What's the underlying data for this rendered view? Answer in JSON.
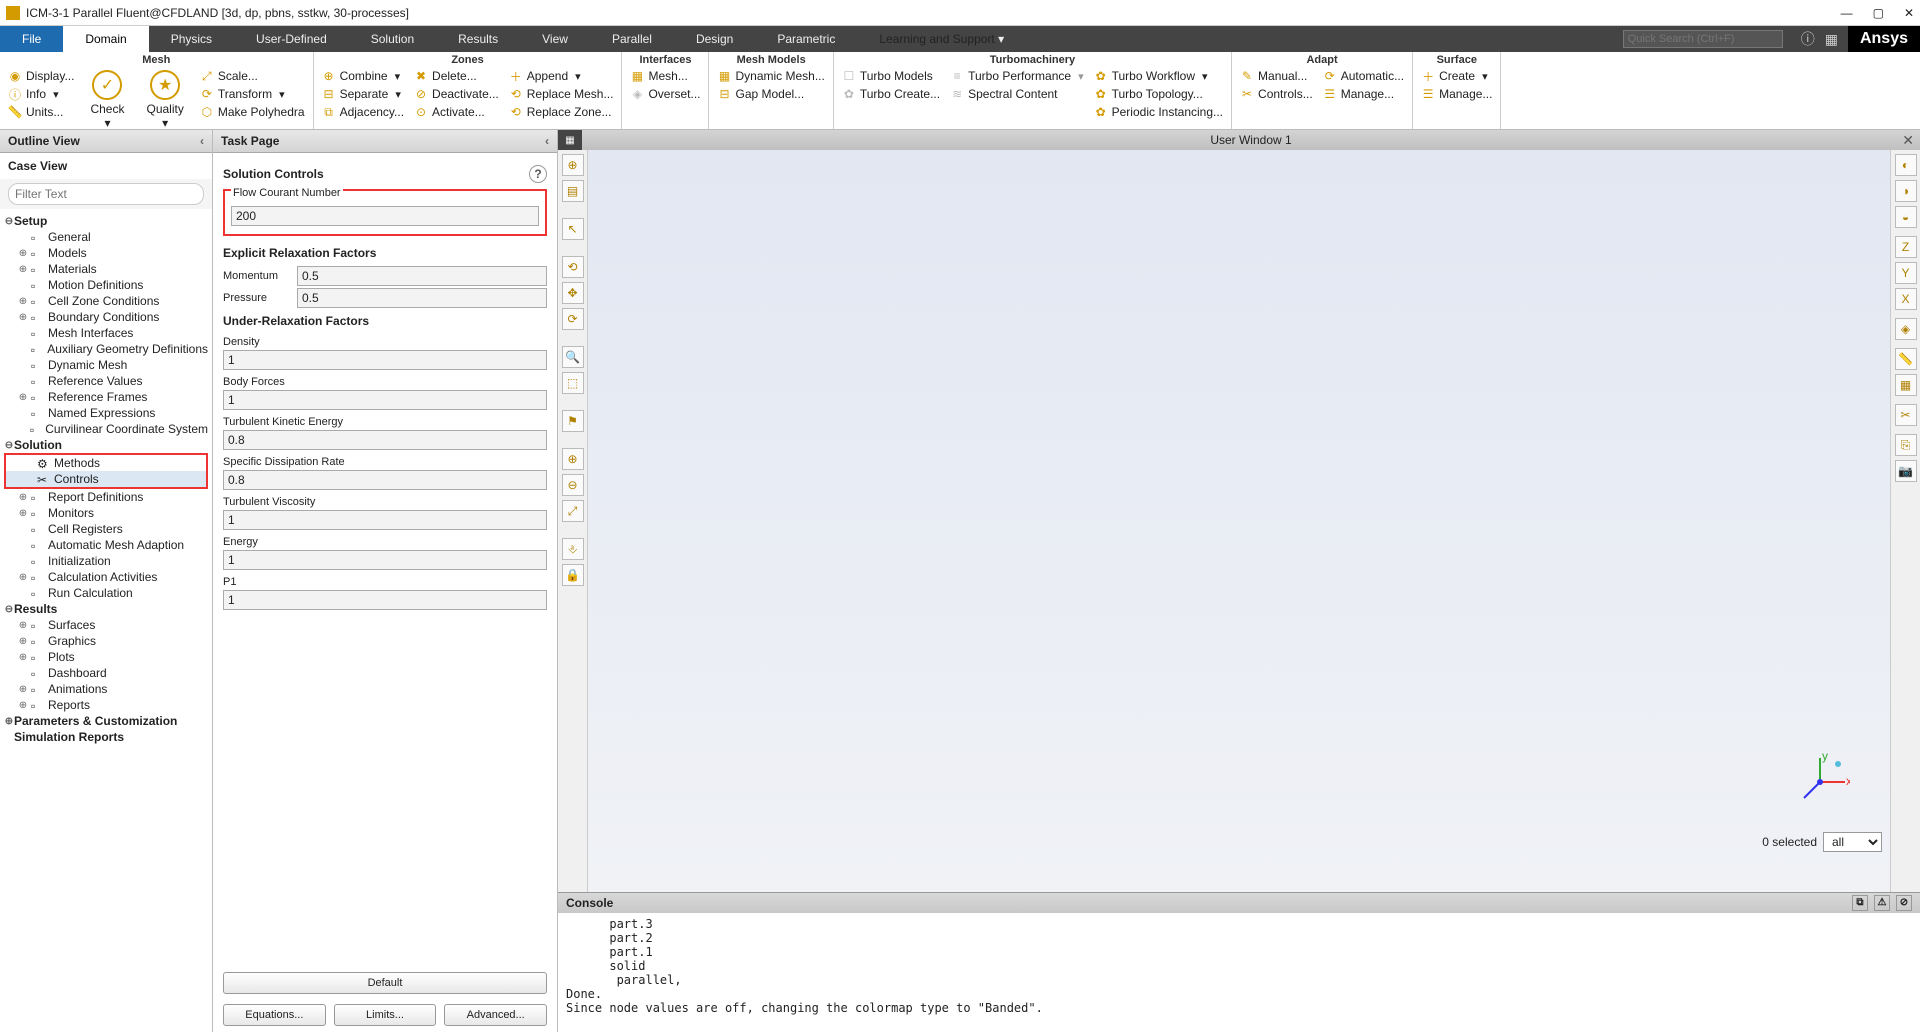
{
  "title": "ICM-3-1 Parallel Fluent@CFDLAND  [3d, dp, pbns, sstkw, 30-processes]",
  "menu": {
    "file": "File",
    "items": [
      "Domain",
      "Physics",
      "User-Defined",
      "Solution",
      "Results",
      "View",
      "Parallel",
      "Design",
      "Parametric",
      "Learning and Support"
    ],
    "active": "Domain",
    "search_ph": "Quick Search (Ctrl+F)",
    "logo": "Ansys"
  },
  "ribbon": {
    "mesh": {
      "head": "Mesh",
      "left": [
        "Display...",
        "Info",
        "Units..."
      ],
      "big": [
        "Check",
        "Quality"
      ],
      "right": [
        "Scale...",
        "Transform",
        "Make Polyhedra"
      ]
    },
    "zones": {
      "head": "Zones",
      "c1": [
        "Combine",
        "Separate",
        "Adjacency..."
      ],
      "c2": [
        "Delete...",
        "Deactivate...",
        "Activate..."
      ],
      "c3": [
        "Append",
        "Replace Mesh...",
        "Replace Zone..."
      ]
    },
    "interfaces": {
      "head": "Interfaces",
      "items": [
        "Mesh...",
        "Overset..."
      ]
    },
    "meshmodels": {
      "head": "Mesh Models",
      "items": [
        "Dynamic Mesh...",
        "Gap Model..."
      ]
    },
    "turbo": {
      "head": "Turbomachinery",
      "c1": [
        "Turbo Models",
        "Turbo Create..."
      ],
      "c2": [
        "Turbo Performance",
        "Spectral Content"
      ],
      "c3": [
        "Turbo Workflow",
        "Turbo Topology...",
        "Periodic Instancing..."
      ]
    },
    "adapt": {
      "head": "Adapt",
      "c1": [
        "Manual...",
        "Controls..."
      ],
      "c2": [
        "Automatic...",
        "Manage..."
      ]
    },
    "surface": {
      "head": "Surface",
      "items": [
        "Create",
        "Manage..."
      ]
    }
  },
  "outline": {
    "head": "Outline View",
    "case": "Case View",
    "filter_ph": "Filter Text",
    "setup": {
      "label": "Setup",
      "items": [
        "General",
        "Models",
        "Materials",
        "Motion Definitions",
        "Cell Zone Conditions",
        "Boundary Conditions",
        "Mesh Interfaces",
        "Auxiliary Geometry Definitions",
        "Dynamic Mesh",
        "Reference Values",
        "Reference Frames",
        "Named Expressions",
        "Curvilinear Coordinate System"
      ]
    },
    "solution": {
      "label": "Solution",
      "items": [
        "Methods",
        "Controls",
        "Report Definitions",
        "Monitors",
        "Cell Registers",
        "Automatic Mesh Adaption",
        "Initialization",
        "Calculation Activities",
        "Run Calculation"
      ],
      "sel": "Controls"
    },
    "results": {
      "label": "Results",
      "items": [
        "Surfaces",
        "Graphics",
        "Plots",
        "Dashboard",
        "Animations",
        "Reports"
      ]
    },
    "extra": [
      "Parameters & Customization",
      "Simulation Reports"
    ]
  },
  "task": {
    "head": "Task Page",
    "title": "Solution Controls",
    "flow": {
      "label": "Flow Courant Number",
      "val": "200"
    },
    "erf": {
      "head": "Explicit Relaxation Factors",
      "momentum_l": "Momentum",
      "momentum_v": "0.5",
      "pressure_l": "Pressure",
      "pressure_v": "0.5"
    },
    "urf": {
      "head": "Under-Relaxation Factors",
      "items": [
        {
          "l": "Density",
          "v": "1"
        },
        {
          "l": "Body Forces",
          "v": "1"
        },
        {
          "l": "Turbulent Kinetic Energy",
          "v": "0.8"
        },
        {
          "l": "Specific Dissipation Rate",
          "v": "0.8"
        },
        {
          "l": "Turbulent Viscosity",
          "v": "1"
        },
        {
          "l": "Energy",
          "v": "1"
        },
        {
          "l": "P1",
          "v": "1"
        }
      ]
    },
    "buttons": {
      "default": "Default",
      "eq": "Equations...",
      "lim": "Limits...",
      "adv": "Advanced..."
    }
  },
  "viewer": {
    "title": "User Window 1",
    "selected": "0 selected",
    "filter": "all"
  },
  "console": {
    "head": "Console",
    "text": "      part.3\n      part.2\n      part.1\n      solid\n       parallel,\nDone.\nSince node values are off, changing the colormap type to \"Banded\".\n\n>"
  }
}
